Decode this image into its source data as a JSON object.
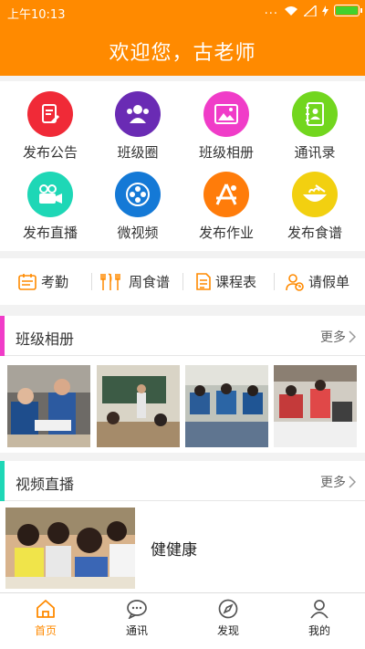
{
  "status": {
    "time": "上午10:13",
    "dots": "..."
  },
  "header": {
    "title": "欢迎您，古老师"
  },
  "grid": [
    {
      "label": "发布公告",
      "icon": "announcement-icon",
      "color": "#f02a37"
    },
    {
      "label": "班级圈",
      "icon": "class-circle-icon",
      "color": "#6a2bb4"
    },
    {
      "label": "班级相册",
      "icon": "photo-album-icon",
      "color": "#f03cc8"
    },
    {
      "label": "通讯录",
      "icon": "contacts-icon",
      "color": "#72d61e"
    },
    {
      "label": "发布直播",
      "icon": "live-camera-icon",
      "color": "#1ed7b6"
    },
    {
      "label": "微视频",
      "icon": "film-reel-icon",
      "color": "#1479d6"
    },
    {
      "label": "发布作业",
      "icon": "homework-icon",
      "color": "#ff7c0a"
    },
    {
      "label": "发布食谱",
      "icon": "recipe-icon",
      "color": "#f2d010"
    }
  ],
  "quick": [
    {
      "label": "考勤",
      "icon": "attendance-icon"
    },
    {
      "label": "周食谱",
      "icon": "utensils-icon"
    },
    {
      "label": "课程表",
      "icon": "schedule-icon"
    },
    {
      "label": "请假单",
      "icon": "leave-request-icon"
    }
  ],
  "album": {
    "title": "班级相册",
    "more": "更多",
    "accent": "#f03cc8"
  },
  "video": {
    "title": "视频直播",
    "more": "更多",
    "accent": "#1ed7b6",
    "item_title": "健健康"
  },
  "tabs": [
    {
      "label": "首页",
      "icon": "home-icon",
      "active": true
    },
    {
      "label": "通讯",
      "icon": "chat-icon",
      "active": false
    },
    {
      "label": "发现",
      "icon": "compass-icon",
      "active": false
    },
    {
      "label": "我的",
      "icon": "profile-icon",
      "active": false
    }
  ],
  "colors": {
    "brand": "#ff8a00"
  }
}
